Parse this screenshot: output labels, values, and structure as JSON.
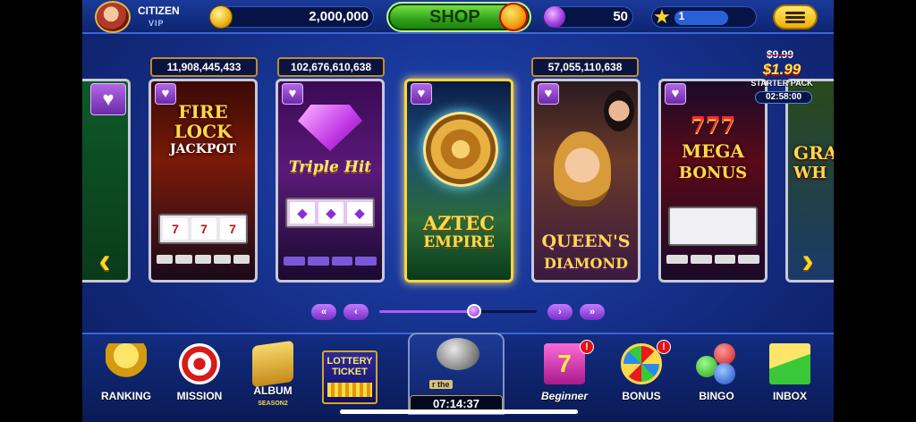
{
  "header": {
    "rank_title": "CITIZEN",
    "rank_sub": "VIP",
    "coins": "2,000,000",
    "shop_label": "SHOP",
    "gems": "50",
    "level": "1"
  },
  "starter_pack": {
    "old_price": "$9.99",
    "new_price": "$1.99",
    "label": "STARTER PACK",
    "timer": "02:58:00"
  },
  "games": [
    {
      "jackpot": "",
      "title": ""
    },
    {
      "jackpot": "11,908,445,433",
      "title_lines": [
        "FIRE",
        "LOCK",
        "JACKPOT"
      ]
    },
    {
      "jackpot": "102,676,610,638",
      "title_lines": [
        "Triple Hit"
      ]
    },
    {
      "jackpot": "",
      "title_lines": [
        "AZTEC",
        "EMPIRE"
      ]
    },
    {
      "jackpot": "57,055,110,638",
      "title_lines": [
        "QUEEN'S",
        "DIAMOND"
      ]
    },
    {
      "jackpot": "",
      "title_lines": [
        "777",
        "MEGA",
        "BONUS"
      ]
    },
    {
      "jackpot": "",
      "title_lines": [
        "GRA",
        "WH"
      ]
    }
  ],
  "pager": {
    "first": "«",
    "prev": "‹",
    "next": "›",
    "last": "»",
    "position": 0.6
  },
  "dock": {
    "ranking": "RANKING",
    "mission": "MISSION",
    "album": "ALBUM",
    "album_sub": "SEASON2",
    "lottery": "LOTTERY TICKET",
    "vault_text": "r the",
    "vault_timer": "07:14:37",
    "beginner": "Beginner",
    "bonus": "BONUS",
    "bingo": "BINGO",
    "inbox": "INBOX",
    "alert": "!"
  },
  "colors": {
    "gold": "#ffd52a",
    "purple": "#8a2ed8",
    "blue_bg": "#142e86",
    "shop_green": "#2e9f18"
  }
}
